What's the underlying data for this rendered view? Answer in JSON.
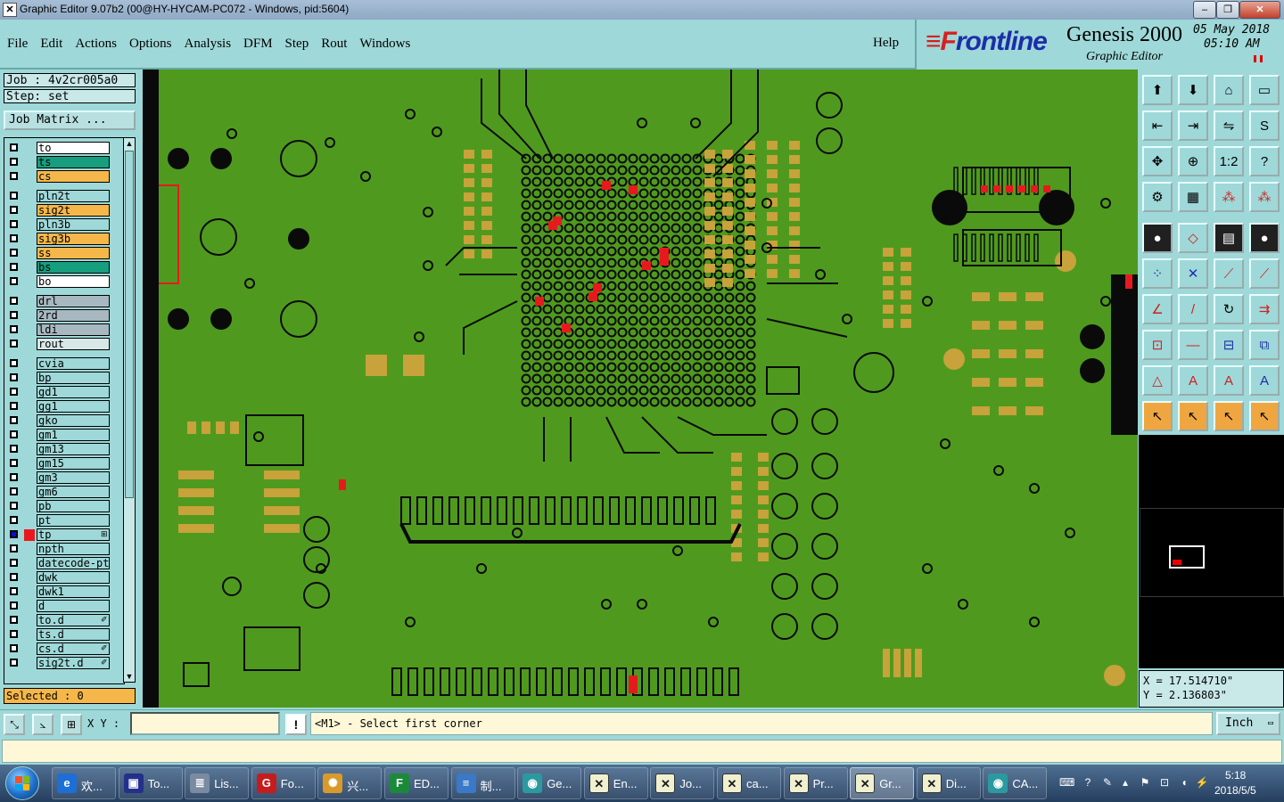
{
  "window": {
    "title": "Graphic Editor 9.07b2 (00@HY-HYCAM-PC072 - Windows, pid:5604)",
    "min_glyph": "–",
    "max_glyph": "❐",
    "close_glyph": "✕"
  },
  "menu": {
    "items": [
      "File",
      "Edit",
      "Actions",
      "Options",
      "Analysis",
      "DFM",
      "Step",
      "Rout",
      "Windows"
    ],
    "help": "Help"
  },
  "brand": {
    "logo_mark": "≡F",
    "logo_text": "rontline",
    "product": "Genesis 2000",
    "subtitle": "Graphic Editor",
    "date": "05 May 2018",
    "time": "05:10 AM"
  },
  "job": {
    "job_line": "Job : 4v2cr005a0",
    "step_line": "Step: set",
    "matrix_button": "Job Matrix ..."
  },
  "layers": [
    {
      "name": "to",
      "color": "#ffffff"
    },
    {
      "name": "ts",
      "color": "#169e7e"
    },
    {
      "name": "cs",
      "color": "#f5b74a"
    },
    {
      "name": "pln2t",
      "color": "#9fd8d8"
    },
    {
      "name": "sig2t",
      "color": "#f5b74a"
    },
    {
      "name": "pln3b",
      "color": "#9fd8d8"
    },
    {
      "name": "sig3b",
      "color": "#f5b74a"
    },
    {
      "name": "ss",
      "color": "#f5b74a"
    },
    {
      "name": "bs",
      "color": "#169e7e"
    },
    {
      "name": "bo",
      "color": "#ffffff"
    },
    {
      "name": "drl",
      "color": "#a8b8c0"
    },
    {
      "name": "2rd",
      "color": "#a8b8c0"
    },
    {
      "name": "ldi",
      "color": "#a8b8c0"
    },
    {
      "name": "rout",
      "color": "#d8e8e8"
    },
    {
      "name": "cvia",
      "color": "#9fd8d8"
    },
    {
      "name": "bp",
      "color": "#9fd8d8"
    },
    {
      "name": "gd1",
      "color": "#9fd8d8"
    },
    {
      "name": "gg1",
      "color": "#9fd8d8"
    },
    {
      "name": "gko",
      "color": "#9fd8d8"
    },
    {
      "name": "gm1",
      "color": "#9fd8d8"
    },
    {
      "name": "gm13",
      "color": "#9fd8d8"
    },
    {
      "name": "gm15",
      "color": "#9fd8d8"
    },
    {
      "name": "gm3",
      "color": "#9fd8d8"
    },
    {
      "name": "gm6",
      "color": "#9fd8d8"
    },
    {
      "name": "pb",
      "color": "#9fd8d8"
    },
    {
      "name": "pt",
      "color": "#9fd8d8"
    },
    {
      "name": "tp",
      "color": "#9fd8d8",
      "active": true,
      "extra": "⊞"
    },
    {
      "name": "npth",
      "color": "#9fd8d8"
    },
    {
      "name": "datecode-pto",
      "color": "#9fd8d8"
    },
    {
      "name": "dwk",
      "color": "#9fd8d8"
    },
    {
      "name": "dwk1",
      "color": "#9fd8d8"
    },
    {
      "name": "d",
      "color": "#9fd8d8"
    },
    {
      "name": "to.d",
      "color": "#9fd8d8",
      "extra": "✐"
    },
    {
      "name": "ts.d",
      "color": "#9fd8d8"
    },
    {
      "name": "cs.d",
      "color": "#9fd8d8",
      "extra": "✐"
    },
    {
      "name": "sig2t.d",
      "color": "#9fd8d8",
      "extra": "✐"
    }
  ],
  "selected": "Selected : 0",
  "scroll": {
    "up": "▲",
    "down": "▼"
  },
  "coords": {
    "x": "X = 17.514710\"",
    "y": "Y = 2.136803\""
  },
  "bottom": {
    "xy_label": "X Y :",
    "xy_value": "",
    "prompt": "<M1> - Select first corner",
    "unit": "Inch",
    "warn": "!"
  },
  "colors": {
    "board": "#4f9a1e",
    "copper_black": "#0a0a0a",
    "pad_orange": "#c8a23a",
    "highlight_red": "#e8191e"
  },
  "tools": [
    {
      "icon": "⬆",
      "name": "tool-zoom-home-icon"
    },
    {
      "icon": "⬇",
      "name": "tool-redraw-icon"
    },
    {
      "icon": "⌂",
      "name": "tool-home-icon"
    },
    {
      "icon": "▭",
      "name": "tool-window-icon"
    },
    {
      "icon": "⇤",
      "name": "tool-pan-left-icon"
    },
    {
      "icon": "⇥",
      "name": "tool-pan-right-icon"
    },
    {
      "icon": "⇋",
      "name": "tool-swap-icon"
    },
    {
      "icon": "S",
      "name": "tool-snap-icon"
    },
    {
      "icon": "✥",
      "name": "tool-fit-icon"
    },
    {
      "icon": "⊕",
      "name": "tool-center-icon"
    },
    {
      "icon": "1:2",
      "name": "tool-scale-icon"
    },
    {
      "icon": "?",
      "name": "tool-query-icon"
    },
    {
      "icon": "⚙",
      "name": "tool-settings-icon"
    },
    {
      "icon": "▦",
      "name": "tool-grid-icon"
    },
    {
      "icon": "⁂",
      "name": "tool-layers-icon",
      "style": "red"
    },
    {
      "icon": "⁂",
      "name": "tool-layers-alt-icon",
      "style": "red"
    },
    {
      "icon": "●",
      "name": "tool-pad-icon",
      "style": "dark"
    },
    {
      "icon": "◇",
      "name": "tool-shape-icon",
      "style": "red"
    },
    {
      "icon": "▤",
      "name": "tool-ruler-icon",
      "style": "dark"
    },
    {
      "icon": "●",
      "name": "tool-circle-icon",
      "style": "dark"
    },
    {
      "icon": "⁘",
      "name": "tool-nodes-icon",
      "style": "blue"
    },
    {
      "icon": "✕",
      "name": "tool-cross-icon",
      "style": "blue"
    },
    {
      "icon": "⟋",
      "name": "tool-line-icon",
      "style": "red"
    },
    {
      "icon": "⟋",
      "name": "tool-line-alt-icon",
      "style": "red"
    },
    {
      "icon": "∠",
      "name": "tool-angle-icon",
      "style": "red"
    },
    {
      "icon": "/",
      "name": "tool-slash-icon",
      "style": "red"
    },
    {
      "icon": "↻",
      "name": "tool-arc-icon"
    },
    {
      "icon": "⇉",
      "name": "tool-offset-icon",
      "style": "red"
    },
    {
      "icon": "⊡",
      "name": "tool-box-icon",
      "style": "red"
    },
    {
      "icon": "—",
      "name": "tool-hline-icon",
      "style": "red"
    },
    {
      "icon": "⊟",
      "name": "tool-measure-icon",
      "style": "blue"
    },
    {
      "icon": "⧉",
      "name": "tool-copy-icon",
      "style": "blue"
    },
    {
      "icon": "△",
      "name": "tool-triangle-icon",
      "style": "red"
    },
    {
      "icon": "A",
      "name": "tool-text-icon",
      "style": "red"
    },
    {
      "icon": "A",
      "name": "tool-text-alt-icon",
      "style": "red"
    },
    {
      "icon": "A",
      "name": "tool-text-blue-icon",
      "style": "blue"
    },
    {
      "icon": "↖",
      "name": "tool-select-icon",
      "style": "orange"
    },
    {
      "icon": "↖",
      "name": "tool-select-box-icon",
      "style": "orange"
    },
    {
      "icon": "↖",
      "name": "tool-select-round-icon",
      "style": "orange"
    },
    {
      "icon": "↖",
      "name": "tool-select-multi-icon",
      "style": "orange"
    }
  ],
  "taskbar": {
    "tasks": [
      {
        "icon": "e",
        "label": "欢...",
        "name": "task-ie",
        "bg": "#1d6fd6"
      },
      {
        "icon": "▣",
        "label": "To...",
        "name": "task-to",
        "bg": "#24308a"
      },
      {
        "icon": "≣",
        "label": "Lis...",
        "name": "task-list",
        "bg": "#7a8aa0"
      },
      {
        "icon": "G",
        "label": "Fo...",
        "name": "task-fo",
        "bg": "#c51d1d"
      },
      {
        "icon": "✺",
        "label": "兴...",
        "name": "task-xing",
        "bg": "#d99a2b"
      },
      {
        "icon": "F",
        "label": "ED...",
        "name": "task-ed",
        "bg": "#1a8a3a"
      },
      {
        "icon": "≡",
        "label": "制...",
        "name": "task-zhi",
        "bg": "#3a78c8"
      },
      {
        "icon": "◉",
        "label": "Ge...",
        "name": "task-ge",
        "bg": "#2a9aa0"
      },
      {
        "icon": "✕",
        "label": "En...",
        "name": "task-en",
        "bg": "#f0f0d0"
      },
      {
        "icon": "✕",
        "label": "Jo...",
        "name": "task-jo",
        "bg": "#f0f0d0"
      },
      {
        "icon": "✕",
        "label": "ca...",
        "name": "task-ca",
        "bg": "#f0f0d0"
      },
      {
        "icon": "✕",
        "label": "Pr...",
        "name": "task-pr",
        "bg": "#f0f0d0"
      },
      {
        "icon": "✕",
        "label": "Gr...",
        "name": "task-gr",
        "bg": "#f0f0d0",
        "active": true
      },
      {
        "icon": "✕",
        "label": "Di...",
        "name": "task-di",
        "bg": "#f0f0d0"
      },
      {
        "icon": "◉",
        "label": "CA...",
        "name": "task-cam",
        "bg": "#2a9aa0"
      }
    ],
    "clock_time": "5:18",
    "clock_date": "2018/5/5"
  }
}
